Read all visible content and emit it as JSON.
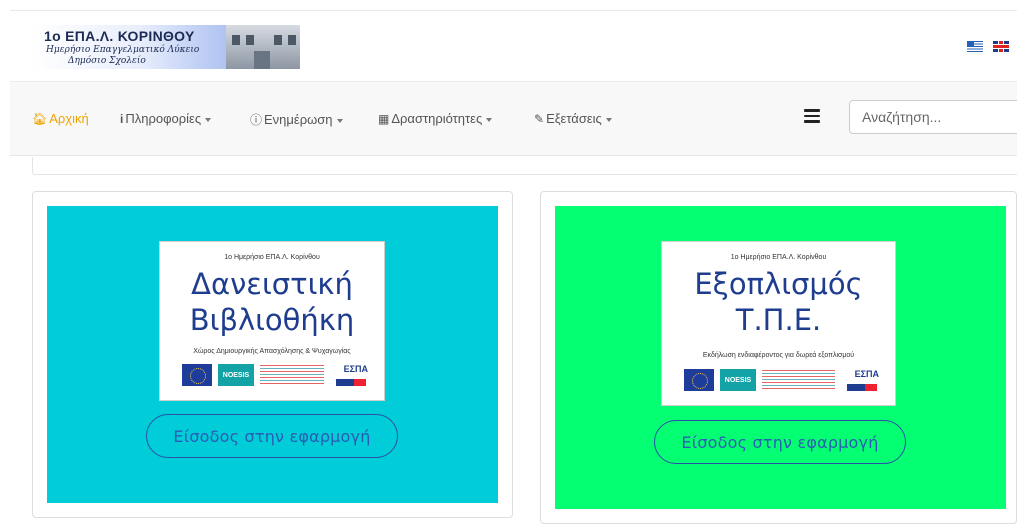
{
  "header": {
    "logo_title": "1ο ΕΠΑ.Λ. ΚΟΡΙΝΘΟΥ",
    "logo_subtitle_1": "Ημερήσιο Επαγγελματικό Λύκειο",
    "logo_subtitle_2": "Δημόσιο Σχολείο",
    "languages": [
      {
        "icon": "greek-flag-icon"
      },
      {
        "icon": "uk-flag-icon"
      }
    ]
  },
  "nav": {
    "items": [
      {
        "label": "Αρχική",
        "icon": "home-icon",
        "dropdown": false,
        "active": true
      },
      {
        "label": "Πληροφορίες",
        "icon": "info-icon",
        "dropdown": true
      },
      {
        "label": "Ενημέρωση",
        "icon": "info-circle-icon",
        "dropdown": true
      },
      {
        "label": "Δραστηριότητες",
        "icon": "calendar-icon",
        "dropdown": true
      },
      {
        "label": "Εξετάσεις",
        "icon": "pencil-icon",
        "dropdown": true
      }
    ],
    "search_placeholder": "Αναζήτηση...",
    "active_color": "#f0a500"
  },
  "cards": [
    {
      "bg_color": "#00cdd8",
      "poster_org": "1ο Ημερήσιο ΕΠΑ.Λ. Κορίνθου",
      "poster_title_1": "Δανειστική",
      "poster_title_2": "Βιβλιοθήκη",
      "poster_subtitle": "Χώρος Δημιουργικής Απασχόλησης & Ψυχαγωγίας",
      "logo_noesis": "NOESIS",
      "logo_espa": "ΕΣΠΑ",
      "button_label": "Είσοδος στην εφαρμογή"
    },
    {
      "bg_color": "#05ff73",
      "poster_org": "1ο Ημερήσιο ΕΠΑ.Λ. Κορίνθου",
      "poster_title_1": "Εξοπλισμός",
      "poster_title_2": "Τ.Π.Ε.",
      "poster_subtitle": "Εκδήλωση ενδιαφέροντος για δωρεά εξοπλισμού",
      "logo_noesis": "NOESIS",
      "logo_espa": "ΕΣΠΑ",
      "button_label": "Είσοδος στην εφαρμογή"
    }
  ]
}
